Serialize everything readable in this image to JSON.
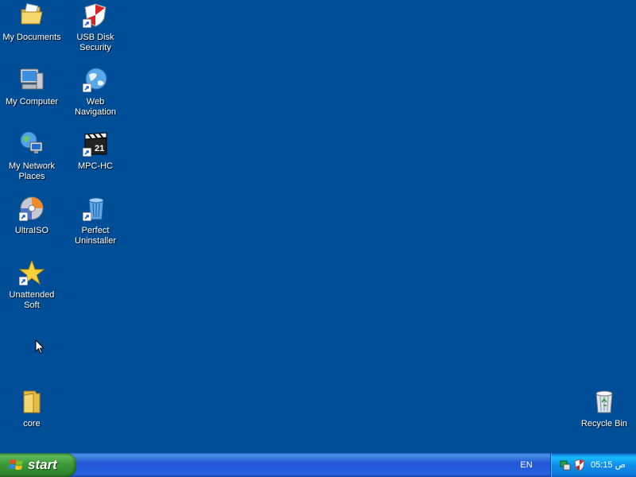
{
  "desktop": {
    "icons": [
      {
        "label": "My Documents"
      },
      {
        "label": "USB Disk Security"
      },
      {
        "label": "My Computer"
      },
      {
        "label": "Web Navigation"
      },
      {
        "label": "My Network Places"
      },
      {
        "label": "MPC-HC"
      },
      {
        "label": "UltraISO"
      },
      {
        "label": "Perfect Uninstaller"
      },
      {
        "label": "Unattended Soft"
      },
      {
        "label": "core"
      },
      {
        "label": "Recycle Bin"
      }
    ]
  },
  "taskbar": {
    "start_label": "start",
    "language": "EN",
    "clock": "05:15 ص"
  },
  "colors": {
    "desktop_bg": "#004e98",
    "start_green": "#3c9a38",
    "taskbar_blue": "#2157d7",
    "tray_blue": "#0f8dea"
  }
}
